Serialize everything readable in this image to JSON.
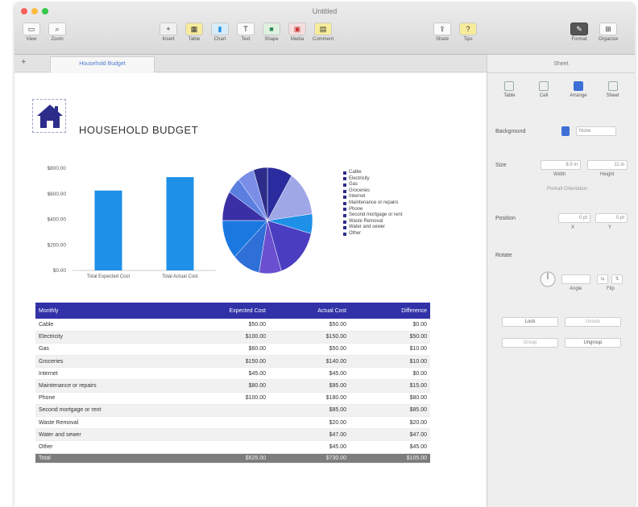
{
  "window": {
    "title": "Untitled",
    "traffic_colors": [
      "#fc605b",
      "#fdbc40",
      "#34c84a"
    ]
  },
  "toolbar": {
    "left": [
      {
        "label": "View",
        "icon": "view-icon"
      },
      {
        "label": "Zoom",
        "icon": "zoom-icon"
      }
    ],
    "center": [
      {
        "label": "Insert",
        "icon": "insert-icon"
      },
      {
        "label": "Table",
        "icon": "table-icon"
      },
      {
        "label": "Chart",
        "icon": "chart-icon"
      },
      {
        "label": "Text",
        "icon": "text-icon"
      },
      {
        "label": "Shape",
        "icon": "shape-icon"
      },
      {
        "label": "Media",
        "icon": "media-icon"
      },
      {
        "label": "Comment",
        "icon": "comment-icon"
      }
    ],
    "right": [
      {
        "label": "Share",
        "icon": "share-icon"
      },
      {
        "label": "Tips",
        "icon": "tips-icon"
      }
    ],
    "far_right": [
      {
        "label": "Format",
        "icon": "format-icon"
      },
      {
        "label": "Organize",
        "icon": "organize-icon"
      }
    ]
  },
  "tabs": {
    "add_symbol": "+",
    "active_sheet": "Household Budget"
  },
  "sheet": {
    "title": "HOUSEHOLD BUDGET"
  },
  "chart_data": [
    {
      "type": "bar",
      "title": "",
      "categories": [
        "Total Expected Cost",
        "Total Actual Cost"
      ],
      "values": [
        625,
        730
      ],
      "ylim": [
        0,
        800
      ],
      "yticks": [
        "$800.00",
        "$600.00",
        "$400.00",
        "$200.00",
        "$0.00"
      ],
      "grid": false,
      "color": "#1e90e8"
    },
    {
      "type": "pie",
      "labels": [
        "Cable",
        "Electricity",
        "Gas",
        "Groceries",
        "Internet",
        "Maintenance or repairs",
        "Phone",
        "Second mortgage or rent",
        "Waste Removal",
        "Water and sewer",
        "Other"
      ],
      "values": [
        9,
        14,
        6,
        16,
        8,
        10,
        12,
        9,
        5,
        6,
        5
      ],
      "colors": [
        "#2b2ba0",
        "#9fa7e6",
        "#1e90e8",
        "#4a3dc0",
        "#6a4fd0",
        "#2f6fd8",
        "#1b78e0",
        "#3b2fa6",
        "#5b7fe0",
        "#7a8ee8",
        "#2c2c8a"
      ],
      "legend_position": "right"
    }
  ],
  "table": {
    "headers": [
      "Monthly",
      "Expected Cost",
      "Actual Cost",
      "Difference"
    ],
    "rows": [
      [
        "Cable",
        "$50.00",
        "$50.00",
        "$0.00"
      ],
      [
        "Electricity",
        "$100.00",
        "$150.00",
        "$50.00"
      ],
      [
        "Gas",
        "$60.00",
        "$50.00",
        "$10.00"
      ],
      [
        "Groceries",
        "$150.00",
        "$140.00",
        "$10.00"
      ],
      [
        "Internet",
        "$45.00",
        "$45.00",
        "$0.00"
      ],
      [
        "Maintenance or repairs",
        "$80.00",
        "$95.00",
        "$15.00"
      ],
      [
        "Phone",
        "$100.00",
        "$180.00",
        "$80.00"
      ],
      [
        "Second mortgage or rent",
        "",
        "$85.00",
        "$85.00"
      ],
      [
        "Waste Removal",
        "",
        "$20.00",
        "$20.00"
      ],
      [
        "Water and sewer",
        "",
        "$47.00",
        "$47.00"
      ],
      [
        "Other",
        "",
        "$45.00",
        "$45.00"
      ]
    ],
    "total": [
      "Total",
      "$625.00",
      "$730.00",
      "$105.00"
    ]
  },
  "inspector": {
    "header": "Sheet",
    "tabs": [
      "Table",
      "Cell",
      "Arrange",
      "Sheet"
    ],
    "background_label": "Background",
    "background_value": "None",
    "size_label": "Size",
    "width": "8.5 in",
    "height": "11 in",
    "width_label": "Width",
    "height_label": "Height",
    "orientation_label": "Portrait Orientation",
    "position_label": "Position",
    "pos_x": "0 pt",
    "pos_y": "0 pt",
    "pos_x_label": "X",
    "pos_y_label": "Y",
    "rotate_label": "Rotate",
    "angle_label": "Angle",
    "flip_label": "Flip",
    "lock_label": "Lock",
    "unlock_label": "Unlock",
    "group_label": "Group",
    "ungroup_label": "Ungroup"
  }
}
